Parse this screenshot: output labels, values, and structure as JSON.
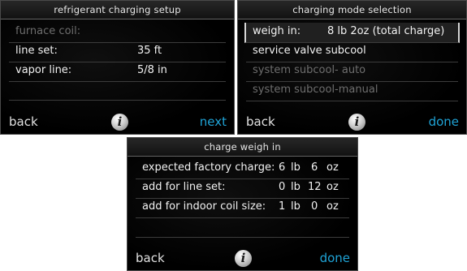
{
  "screen1": {
    "title": "refrigerant charging setup",
    "rows": [
      {
        "label": "furnace coil:",
        "value": "",
        "dim": true
      },
      {
        "label": "line set:",
        "value": "35  ft",
        "dim": false
      },
      {
        "label": "vapor line:",
        "value": "5/8  in",
        "dim": false
      }
    ],
    "back": "back",
    "info": "i",
    "next": "next"
  },
  "screen2": {
    "title": "charging mode selection",
    "rows": [
      {
        "label": "weigh in:",
        "value": "8  lb   2oz (total charge)",
        "selected": true,
        "dim": false
      },
      {
        "label": "service valve subcool",
        "dim": false
      },
      {
        "label": "system subcool- auto",
        "dim": true
      },
      {
        "label": "system subcool-manual",
        "dim": true
      }
    ],
    "back": "back",
    "info": "i",
    "done": "done"
  },
  "screen3": {
    "title": "charge weigh in",
    "rows": [
      {
        "label": "expected factory charge:",
        "lb": "6",
        "lb_unit": "lb",
        "oz": "6",
        "oz_unit": "oz"
      },
      {
        "label": "add for line set:",
        "lb": "0",
        "lb_unit": "lb",
        "oz": "12",
        "oz_unit": "oz"
      },
      {
        "label": "add for indoor coil size:",
        "lb": "1",
        "lb_unit": "lb",
        "oz": "0",
        "oz_unit": "oz"
      }
    ],
    "back": "back",
    "info": "i",
    "done": "done"
  },
  "colors": {
    "accent": "#1fa3d6",
    "text": "#f2f2f2",
    "dim": "#6e6e6e",
    "background": "#000000"
  }
}
